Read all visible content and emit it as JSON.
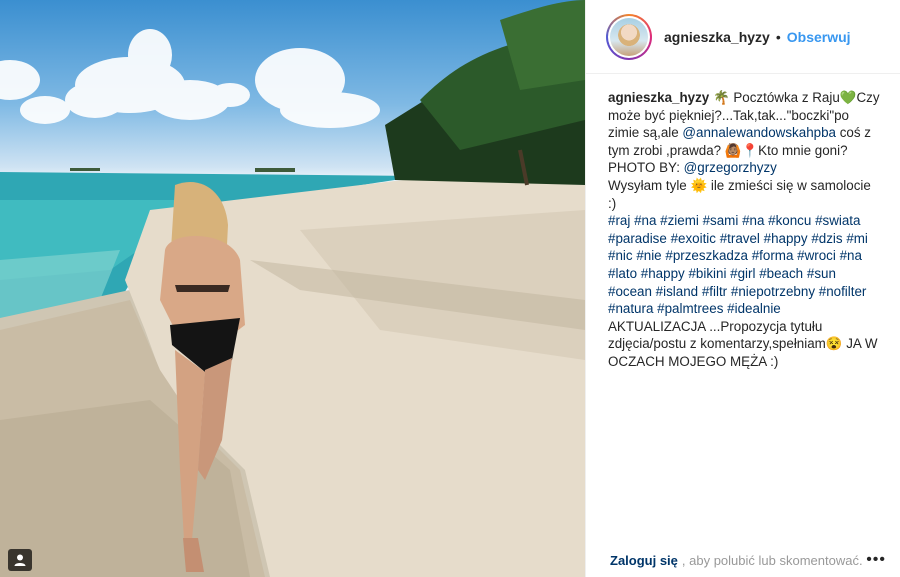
{
  "post": {
    "username": "agnieszka_hyzy",
    "separator": "•",
    "follow_label": "Obserwuj",
    "caption_parts": {
      "p1a": " 🌴 Pocztówka z Raju",
      "p1b": "💚",
      "p1c": "Czy może być piękniej?...Tak,tak...\"boczki\"po zimie są,ale ",
      "mention1": "@annalewandowskahpba",
      "p1d": " coś z tym zrobi ,prawda? 🙆🏽📍Kto mnie goni? PHOTO BY: ",
      "mention2": "@grzegorzhyzy",
      "p2": "Wysyłam tyle 🌞 ile zmieści się w samolocie :)",
      "hashtags": [
        "#raj",
        "#na",
        "#ziemi",
        "#sami",
        "#na",
        "#koncu",
        "#swiata",
        "#paradise",
        "#exoitic",
        "#travel",
        "#happy",
        "#dzis",
        "#mi",
        "#nic",
        "#nie",
        "#przeszkadza",
        "#forma",
        "#wroci",
        "#na",
        "#lato",
        "#happy",
        "#bikini",
        "#girl",
        "#beach",
        "#sun",
        "#ocean",
        "#island",
        "#filtr",
        "#niepotrzebny",
        "#nofilter",
        "#natura",
        "#palmtrees",
        "#idealnie"
      ],
      "p3": "AKTUALIZACJA ...Propozycja tytułu zdjęcia/postu z komentarzy,spełniam😵 JA W OCZACH MOJEGO MĘŻA :)"
    },
    "footer": {
      "login_label": "Zaloguj się",
      "login_text": ", aby polubić lub skomentować.",
      "more_label": "•••"
    }
  },
  "icons": {
    "photo_badge": "user-tag-icon",
    "more": "more-options-icon"
  },
  "colors": {
    "link": "#003569",
    "follow": "#3897f0",
    "muted": "#999999"
  }
}
